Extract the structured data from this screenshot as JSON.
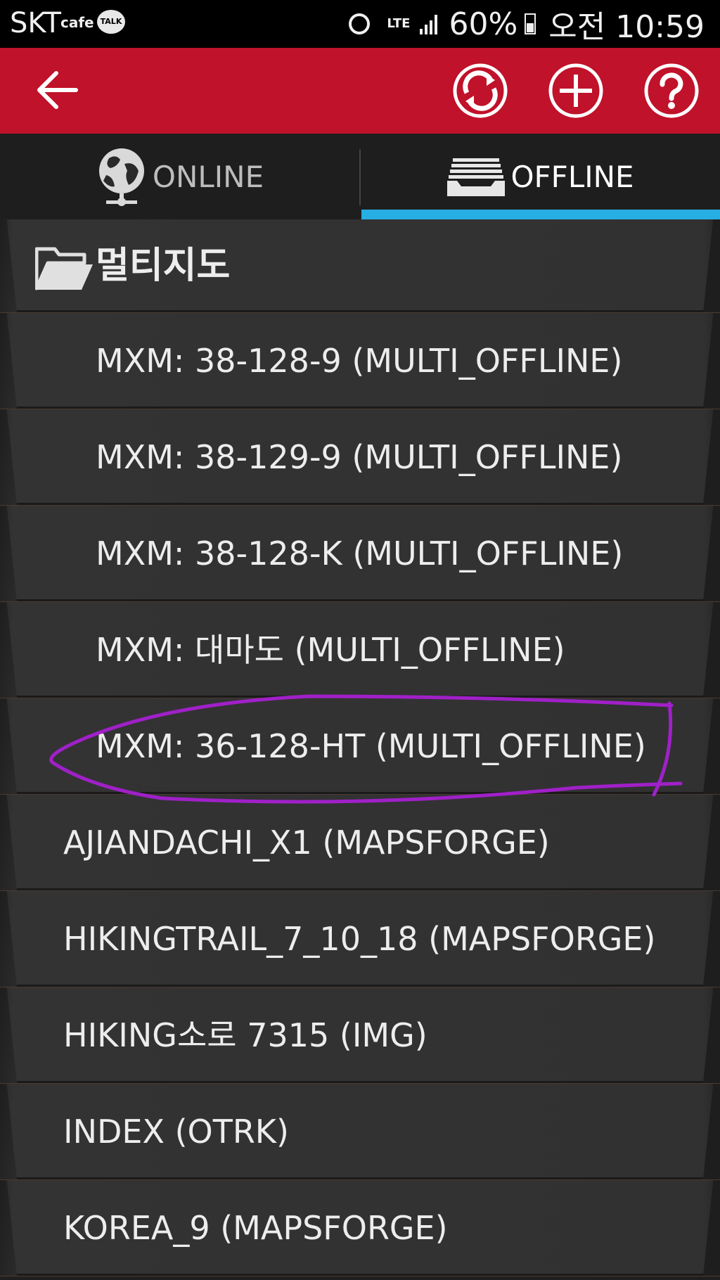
{
  "status_bar": {
    "carrier": "SKT",
    "cafe": "cafe",
    "talk": "TALK",
    "network": "LTE",
    "battery": "60%",
    "time": "오전 10:59"
  },
  "tabs": {
    "online_label": "ONLINE",
    "offline_label": "OFFLINE",
    "selected": "OFFLINE"
  },
  "folder": {
    "label": "멀티지도"
  },
  "items": [
    "MXM: 38-128-9 (MULTI_OFFLINE)",
    "MXM: 38-129-9 (MULTI_OFFLINE)",
    "MXM: 38-128-K (MULTI_OFFLINE)",
    "MXM: 대마도 (MULTI_OFFLINE)",
    "MXM: 36-128-HT (MULTI_OFFLINE)",
    "AJIANDACHI_X1 (MAPSFORGE)",
    "HIKINGTRAIL_7_10_18 (MAPSFORGE)",
    "HIKING소로 7315 (IMG)",
    "INDEX (OTRK)",
    "KOREA_9 (MAPSFORGE)"
  ],
  "colors": {
    "toolbar": "#c0122a",
    "tab_indicator": "#27aee3",
    "annotation": "#a020c8"
  },
  "icons": [
    "back-arrow-icon",
    "sync-icon",
    "add-icon",
    "help-icon",
    "globe-icon",
    "offline-stack-icon",
    "folder-icon"
  ]
}
